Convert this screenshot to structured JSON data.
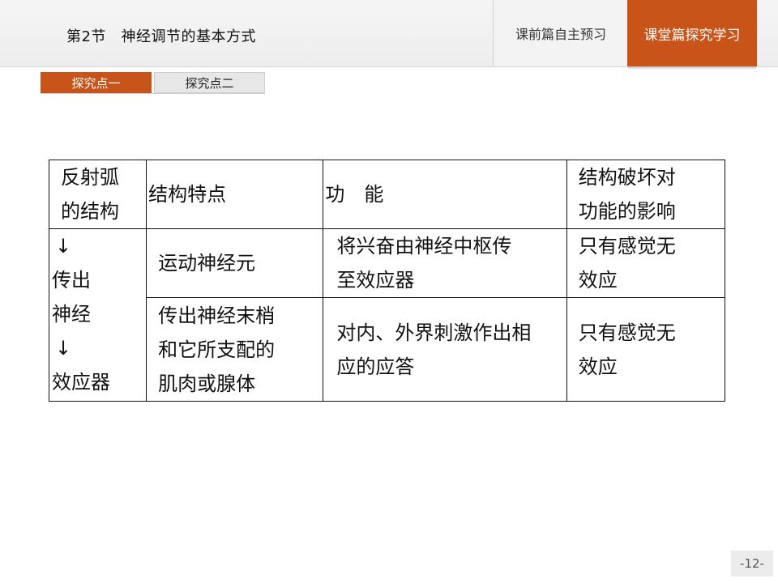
{
  "header": {
    "section_title": "第2节　神经调节的基本方式",
    "nav_preview_label": "课前篇自主预习",
    "nav_current_label": "课堂篇探究学习"
  },
  "tabs": [
    {
      "label": "探究点一",
      "active": true
    },
    {
      "label": "探究点二",
      "active": false
    }
  ],
  "table": {
    "headers": {
      "col1": [
        "反射弧",
        "的结构"
      ],
      "col2": "结构特点",
      "col3": "功　能",
      "col4": [
        "结构破坏对",
        "功能的影响"
      ]
    },
    "side_label": {
      "arrow_top": "↓",
      "lines": [
        "传出",
        "神经"
      ],
      "arrow_bottom": "↓",
      "last": "效应器"
    },
    "rows": [
      {
        "feature": "运动神经元",
        "function": [
          "将兴奋由神经中枢传",
          "至效应器"
        ],
        "damage": [
          "只有感觉无",
          "效应"
        ]
      },
      {
        "feature": [
          "传出神经末梢",
          "和它所支配的",
          "肌肉或腺体"
        ],
        "function": [
          "对内、外界刺激作出相",
          "应的应答"
        ],
        "damage": [
          "只有感觉无",
          "效应"
        ]
      }
    ]
  },
  "footer": {
    "page_number": "-12-"
  },
  "colors": {
    "accent": "#c8541a"
  }
}
